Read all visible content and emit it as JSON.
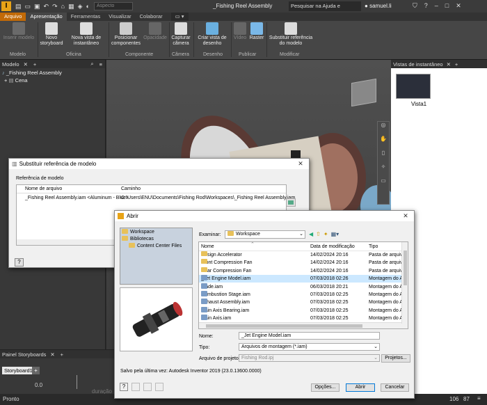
{
  "titlebar": {
    "appearance": "Aspecto",
    "doc_title": "_Fishing Reel Assembly",
    "search": "Pesquisar na Ajuda e comandos.",
    "user": "samuel.li"
  },
  "tabs": [
    "Arquivo",
    "Apresentação",
    "Ferramentas",
    "Visualizar",
    "Colaborar"
  ],
  "ribbon": {
    "buttons": [
      "Inserir modelo",
      "Novo storyboard",
      "Nova vista de instantâneo",
      "Posicionar componentes",
      "Opacidade",
      "Capturar câmera",
      "Criar vista de desenho",
      "Vídeo",
      "Raster",
      "Substituir referência do modelo"
    ],
    "panels": [
      "Modelo",
      "Oficina",
      "Componente",
      "Câmera",
      "Desenho",
      "Publicar",
      "Modificar"
    ]
  },
  "browser": {
    "title": "Modelo",
    "root": "_Fishing Reel Assembly",
    "child": "Cena"
  },
  "snapshots": {
    "title": "Vistas de instantâneo",
    "item": "Vista1"
  },
  "storyboard": {
    "panel_title": "Painel Storyboards",
    "tab": "Storyboard1",
    "time": "0.0",
    "hint": "duração"
  },
  "status": {
    "text": "Pronto",
    "n1": "106",
    "n2": "87"
  },
  "replace_dialog": {
    "title": "Substituir referência de modelo",
    "group": "Referência de modelo",
    "col_name": "Nome de arquivo",
    "col_path": "Caminho",
    "row_name": "_Fishing Reel Assembly.iam <Aluminum - Blue>",
    "row_path": "C:\\Users\\ENU\\Documents\\Fishing Rod\\Workspaces\\_Fishing Reel Assembly.iam"
  },
  "open_dialog": {
    "title": "Abrir",
    "locations": [
      "Workspace",
      "Bibliotecas",
      "Content Center Files"
    ],
    "examinar_label": "Examinar:",
    "examinar_value": "Workspace",
    "columns": [
      "Nome",
      "Data de modificação",
      "Tipo"
    ],
    "files": [
      {
        "name": "Design Accelerator",
        "date": "14/02/2024 20:16",
        "type": "Pasta de arquivo",
        "kind": "folder"
      },
      {
        "name": "Front Compression Fan",
        "date": "14/02/2024 20:16",
        "type": "Pasta de arquivo",
        "kind": "folder"
      },
      {
        "name": "Rear Compression Fan",
        "date": "14/02/2024 20:16",
        "type": "Pasta de arquivo",
        "kind": "folder"
      },
      {
        "name": "_Jet Engine Model.iam",
        "date": "07/03/2018 02:26",
        "type": "Montagem do A",
        "kind": "asm"
      },
      {
        "name": "Blade.iam",
        "date": "06/03/2018 20:21",
        "type": "Montagem do A",
        "kind": "asm"
      },
      {
        "name": "Combustion Stage.iam",
        "date": "07/03/2018 02:25",
        "type": "Montagem do A",
        "kind": "asm"
      },
      {
        "name": "Exhaust Assembly.iam",
        "date": "07/03/2018 02:25",
        "type": "Montagem do A",
        "kind": "asm"
      },
      {
        "name": "Main Axis Bearing.iam",
        "date": "07/03/2018 02:25",
        "type": "Montagem do A",
        "kind": "asm"
      },
      {
        "name": "Main Axis.iam",
        "date": "07/03/2018 02:25",
        "type": "Montagem do A",
        "kind": "asm"
      }
    ],
    "name_label": "Nome:",
    "name_value": "_Jet Engine Model.iam",
    "type_label": "Tipo:",
    "type_value": "Arquivos de montagem (*.iam)",
    "project_label": "Arquivo de projeto:",
    "project_value": "Fishing Rod.ipj",
    "projects_btn": "Projetos...",
    "saved_by": "Salvo pela última vez: Autodesk Inventor 2019 (23.0.13600.0000)",
    "options_btn": "Opções...",
    "open_btn": "Abrir",
    "cancel_btn": "Cancelar"
  },
  "colors": {
    "accent": "#c26a07",
    "selection": "#cce8ff",
    "folder": "#e8c15a"
  }
}
